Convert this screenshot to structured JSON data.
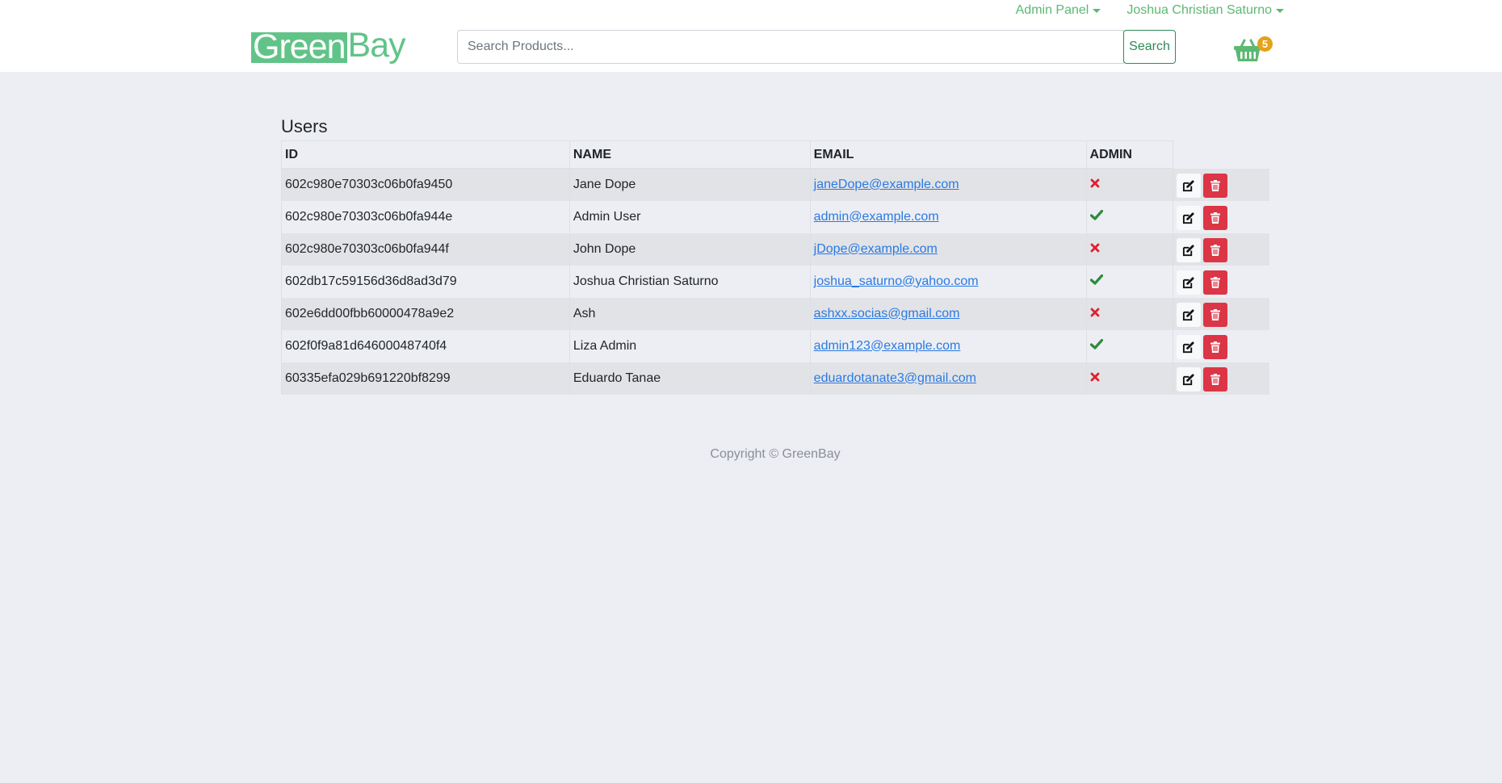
{
  "header": {
    "admin_panel_label": "Admin Panel",
    "user_name": "Joshua Christian Saturno",
    "logo_part1": "Green",
    "logo_part2": "Bay",
    "search_placeholder": "Search Products...",
    "search_button": "Search",
    "cart_count": "5"
  },
  "main": {
    "title": "Users",
    "columns": [
      "ID",
      "NAME",
      "EMAIL",
      "ADMIN"
    ],
    "rows": [
      {
        "id": "602c980e70303c06b0fa9450",
        "name": "Jane Dope",
        "email": "janeDope@example.com",
        "admin": false
      },
      {
        "id": "602c980e70303c06b0fa944e",
        "name": "Admin User",
        "email": "admin@example.com",
        "admin": true
      },
      {
        "id": "602c980e70303c06b0fa944f",
        "name": "John Dope",
        "email": "jDope@example.com",
        "admin": false
      },
      {
        "id": "602db17c59156d36d8ad3d79",
        "name": "Joshua Christian Saturno",
        "email": "joshua_saturno@yahoo.com",
        "admin": true
      },
      {
        "id": "602e6dd00fbb60000478a9e2",
        "name": "Ash",
        "email": "ashxx.socias@gmail.com",
        "admin": false
      },
      {
        "id": "602f0f9a81d64600048740f4",
        "name": "Liza Admin",
        "email": "admin123@example.com",
        "admin": true
      },
      {
        "id": "60335efa029b691220bf8299",
        "name": "Eduardo Tanae",
        "email": "eduardotanate3@gmail.com",
        "admin": false
      }
    ]
  },
  "footer": {
    "text": "Copyright © GreenBay"
  },
  "colors": {
    "brand_green": "#62c389",
    "link_green": "#5cb873",
    "delete_red": "#dc3545",
    "cart_badge": "#e3a21a"
  },
  "icons": {
    "cart": "basket-icon",
    "edit": "edit-icon",
    "delete": "trash-icon",
    "admin_yes": "check-icon",
    "admin_no": "x-icon"
  }
}
